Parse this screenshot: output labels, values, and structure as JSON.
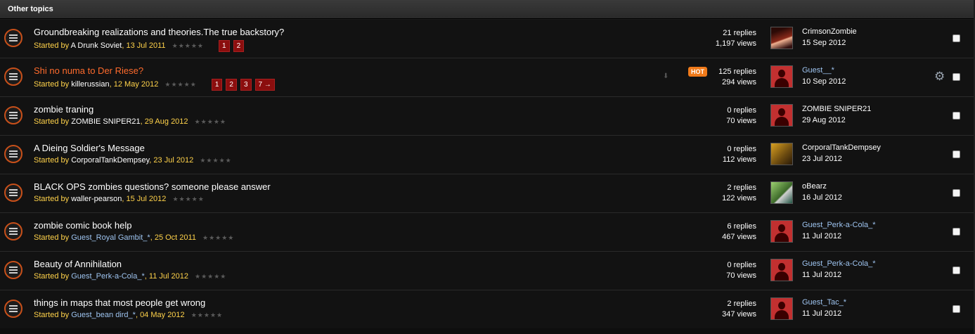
{
  "header": {
    "title": "Other topics"
  },
  "started_by_label": "Started by",
  "stars": "★★★★★",
  "topics": [
    {
      "title": "Groundbreaking realizations and theories.The true backstory?",
      "author": "A Drunk Soviet",
      "date": "13 Jul 2011",
      "pages": [
        "1",
        "2"
      ],
      "replies": "21 replies",
      "views": "1,197 views",
      "last_poster": "CrimsonZombie",
      "last_date": "15 Sep 2012"
    },
    {
      "title": "Shi no numa to Der Riese?",
      "author": "killerussian",
      "date": "12 May 2012",
      "pages": [
        "1",
        "2",
        "3",
        "7 →"
      ],
      "hot": "HOT",
      "replies": "125 replies",
      "views": "294 views",
      "last_poster": "Guest__*",
      "last_date": "10 Sep 2012"
    },
    {
      "title": "zombie traning",
      "author": "ZOMBIE SNIPER21",
      "date": "29 Aug 2012",
      "replies": "0 replies",
      "views": "70 views",
      "last_poster": "ZOMBIE SNIPER21",
      "last_date": "29 Aug 2012"
    },
    {
      "title": "A Dieing Soldier's Message",
      "author": "CorporalTankDempsey",
      "date": "23 Jul 2012",
      "replies": "0 replies",
      "views": "112 views",
      "last_poster": "CorporalTankDempsey",
      "last_date": "23 Jul 2012"
    },
    {
      "title": "BLACK OPS zombies questions? someone please answer",
      "author": "waller-pearson",
      "date": "15 Jul 2012",
      "replies": "2 replies",
      "views": "122 views",
      "last_poster": "oBearz",
      "last_date": "16 Jul 2012"
    },
    {
      "title": "zombie comic book help",
      "author": "Guest_Royal Gambit_*",
      "date": "25 Oct 2011",
      "replies": "6 replies",
      "views": "467 views",
      "last_poster": "Guest_Perk-a-Cola_*",
      "last_date": "11 Jul 2012"
    },
    {
      "title": "Beauty of Annihilation",
      "author": "Guest_Perk-a-Cola_*",
      "date": "11 Jul 2012",
      "replies": "0 replies",
      "views": "70 views",
      "last_poster": "Guest_Perk-a-Cola_*",
      "last_date": "11 Jul 2012"
    },
    {
      "title": "things in maps that most people get wrong",
      "author": "Guest_bean dird_*",
      "date": "04 May 2012",
      "replies": "2 replies",
      "views": "347 views",
      "last_poster": "Guest_Tac_*",
      "last_date": "11 Jul 2012"
    }
  ],
  "icons": {
    "topic": "topic-status-icon",
    "moderation": "gear-icon",
    "sort": "arrow-down-icon"
  },
  "colors": {
    "hot_title": "#ff6b2c",
    "hot_badge": "#f07a1a",
    "date": "#ffd24a",
    "guest_name": "#9ec4f0",
    "page_button": "#8b0e0e"
  }
}
